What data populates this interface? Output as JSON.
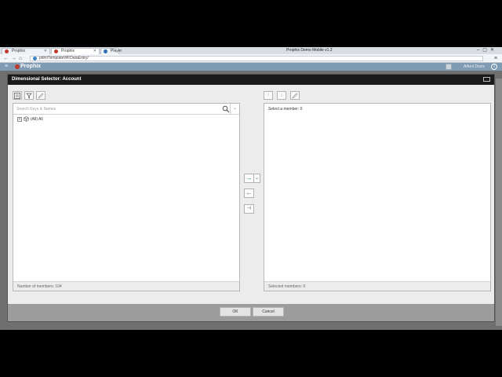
{
  "browser": {
    "tabs": [
      {
        "label": "Prophix"
      },
      {
        "label": "Prophix"
      },
      {
        "label": "Player"
      }
    ],
    "window_title": "Prophix Demo Mobile v1.2",
    "url": "pdm/TemplateWFDataEntry/"
  },
  "app": {
    "logo": "Prophix",
    "user_name": "Alfred Davis"
  },
  "dialog": {
    "title": "Dimensional Selector: Account",
    "left": {
      "search_placeholder": "Search Keys & Names",
      "tree": [
        {
          "label": "(All) All"
        }
      ],
      "footer": "Number of members: 104"
    },
    "right": {
      "title": "Select a member: 0",
      "footer": "Selected members: 0"
    },
    "ok_label": "OK",
    "cancel_label": "Cancel"
  },
  "colors": {
    "dialog_header": "#1a1a1a",
    "accent_green": "#2d8f4e",
    "app_bar": "#7f9ab3"
  }
}
